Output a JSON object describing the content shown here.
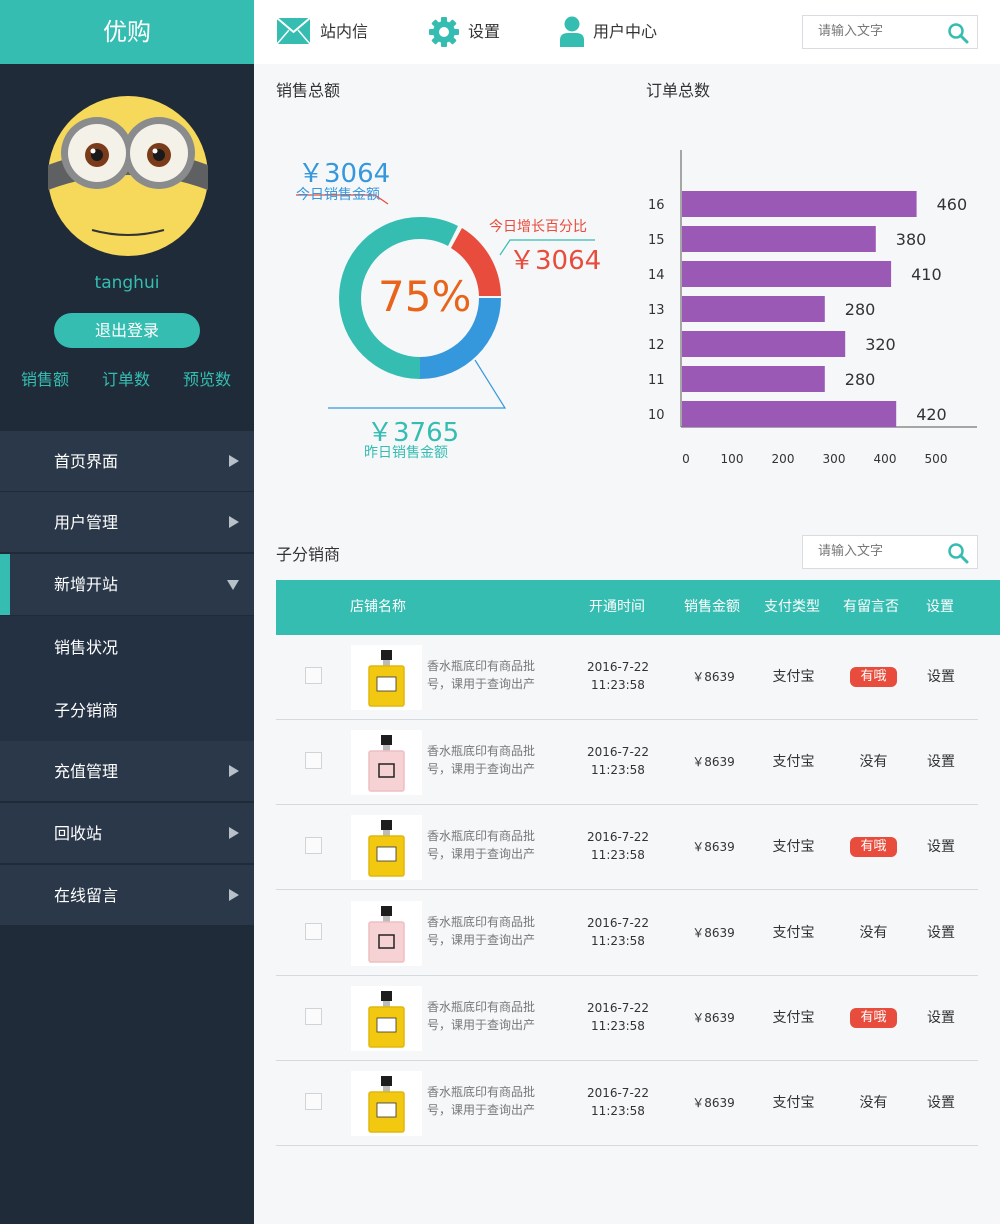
{
  "sidebar": {
    "logo": "优购",
    "username": "tanghui",
    "logout": "退出登录",
    "stats": [
      "销售额",
      "订单数",
      "预览数"
    ],
    "nav": [
      {
        "label": "首页界面"
      },
      {
        "label": "用户管理"
      },
      {
        "label": "新增开站"
      },
      {
        "label": "销售状况"
      },
      {
        "label": "子分销商"
      },
      {
        "label": "充值管理"
      },
      {
        "label": "回收站"
      },
      {
        "label": "在线留言"
      }
    ]
  },
  "topbar": {
    "messages": "站内信",
    "settings": "设置",
    "user_center": "用户中心",
    "search_placeholder": "请输入文字"
  },
  "sales": {
    "title": "销售总额",
    "today_amount": "￥3064",
    "today_label": "今日销售金额",
    "growth_label": "今日增长百分比",
    "growth_amount": "￥3064",
    "percent": "75%",
    "yesterday_amount": "￥3765",
    "yesterday_label": "昨日销售金额",
    "colors": {
      "teal": "#35bdb2",
      "red": "#e74c3c",
      "blue": "#3598dc",
      "orange": "#e8641b"
    }
  },
  "orders": {
    "title": "订单总数"
  },
  "chart_data": {
    "type": "bar",
    "orientation": "horizontal",
    "categories": [
      "16",
      "15",
      "14",
      "13",
      "12",
      "11",
      "10"
    ],
    "values": [
      460,
      380,
      410,
      280,
      320,
      280,
      420
    ],
    "xticks": [
      0,
      100,
      200,
      300,
      400,
      500
    ],
    "xlim": [
      0,
      500
    ],
    "color": "#9b59b6",
    "title": "",
    "xlabel": "",
    "ylabel": ""
  },
  "distributors": {
    "title": "子分销商",
    "search_placeholder": "请输入文字",
    "columns": {
      "name": "店铺名称",
      "open_time": "开通时间",
      "amount": "销售金额",
      "pay_type": "支付类型",
      "has_msg": "有留言否",
      "settings": "设置"
    },
    "rows": [
      {
        "desc": "香水瓶底印有商品批号，课用于查询出产",
        "date": "2016-7-22",
        "time": "11:23:58",
        "amount": "￥8639",
        "pay": "支付宝",
        "msg": "有哦",
        "has_msg": true,
        "set": "设置",
        "product": "yellow"
      },
      {
        "desc": "香水瓶底印有商品批号，课用于查询出产",
        "date": "2016-7-22",
        "time": "11:23:58",
        "amount": "￥8639",
        "pay": "支付宝",
        "msg": "没有",
        "has_msg": false,
        "set": "设置",
        "product": "pink"
      },
      {
        "desc": "香水瓶底印有商品批号，课用于查询出产",
        "date": "2016-7-22",
        "time": "11:23:58",
        "amount": "￥8639",
        "pay": "支付宝",
        "msg": "有哦",
        "has_msg": true,
        "set": "设置",
        "product": "yellow"
      },
      {
        "desc": "香水瓶底印有商品批号，课用于查询出产",
        "date": "2016-7-22",
        "time": "11:23:58",
        "amount": "￥8639",
        "pay": "支付宝",
        "msg": "没有",
        "has_msg": false,
        "set": "设置",
        "product": "pink"
      },
      {
        "desc": "香水瓶底印有商品批号，课用于查询出产",
        "date": "2016-7-22",
        "time": "11:23:58",
        "amount": "￥8639",
        "pay": "支付宝",
        "msg": "有哦",
        "has_msg": true,
        "set": "设置",
        "product": "yellow"
      },
      {
        "desc": "香水瓶底印有商品批号，课用于查询出产",
        "date": "2016-7-22",
        "time": "11:23:58",
        "amount": "￥8639",
        "pay": "支付宝",
        "msg": "没有",
        "has_msg": false,
        "set": "设置",
        "product": "yellow"
      }
    ]
  }
}
